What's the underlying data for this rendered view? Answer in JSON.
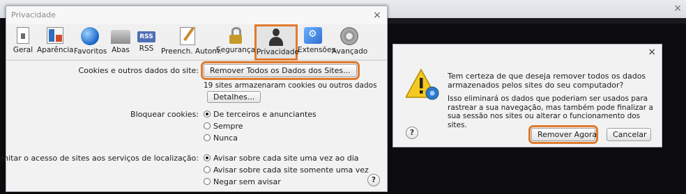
{
  "prefs": {
    "title": "Privacidade",
    "close": "×",
    "toolbar": [
      {
        "label": "Geral",
        "icon": "general-switch-icon"
      },
      {
        "label": "Aparência",
        "icon": "appearance-icon"
      },
      {
        "label": "Favoritos",
        "icon": "bookmarks-globe-icon"
      },
      {
        "label": "Abas",
        "icon": "tabs-icon"
      },
      {
        "label": "RSS",
        "icon": "rss-icon",
        "badge": "RSS"
      },
      {
        "label": "Preench. Autom.",
        "icon": "autofill-pencil-icon"
      },
      {
        "label": "Segurança",
        "icon": "security-lock-icon"
      },
      {
        "label": "Privacidade",
        "icon": "privacy-person-icon",
        "active": true
      },
      {
        "label": "Extensões",
        "icon": "extensions-icon"
      },
      {
        "label": "Avançado",
        "icon": "advanced-gear-icon"
      }
    ],
    "cookies_label": "Cookies e outros dados do site:",
    "remove_all_button": "Remover Todos os Dados dos Sites...",
    "sites_stored": "19 sites armazenaram cookies ou outros dados",
    "details_button": "Detalhes...",
    "block_label": "Bloquear cookies:",
    "block_options": [
      {
        "label": "De terceiros e anunciantes",
        "selected": true
      },
      {
        "label": "Sempre",
        "selected": false
      },
      {
        "label": "Nunca",
        "selected": false
      }
    ],
    "location_label": "Limitar o acesso de sites aos serviços de localização:",
    "location_options": [
      {
        "label": "Avisar sobre cada site uma vez ao dia",
        "selected": true
      },
      {
        "label": "Avisar sobre cada site somente uma vez",
        "selected": false
      },
      {
        "label": "Negar sem avisar",
        "selected": false
      }
    ],
    "help": "?"
  },
  "dialog": {
    "close": "×",
    "title": "Tem certeza de que deseja remover todos os dados armazenados pelos sites do seu computador?",
    "body": "Isso eliminará os dados que poderiam ser usados para rastrear a sua navegação, mas também pode finalizar a sua sessão nos sites ou alterar o funcionamento dos sites.",
    "help": "?",
    "confirm_button": "Remover Agora",
    "cancel_button": "Cancelar"
  },
  "colors": {
    "highlight": "#e07a2e"
  }
}
